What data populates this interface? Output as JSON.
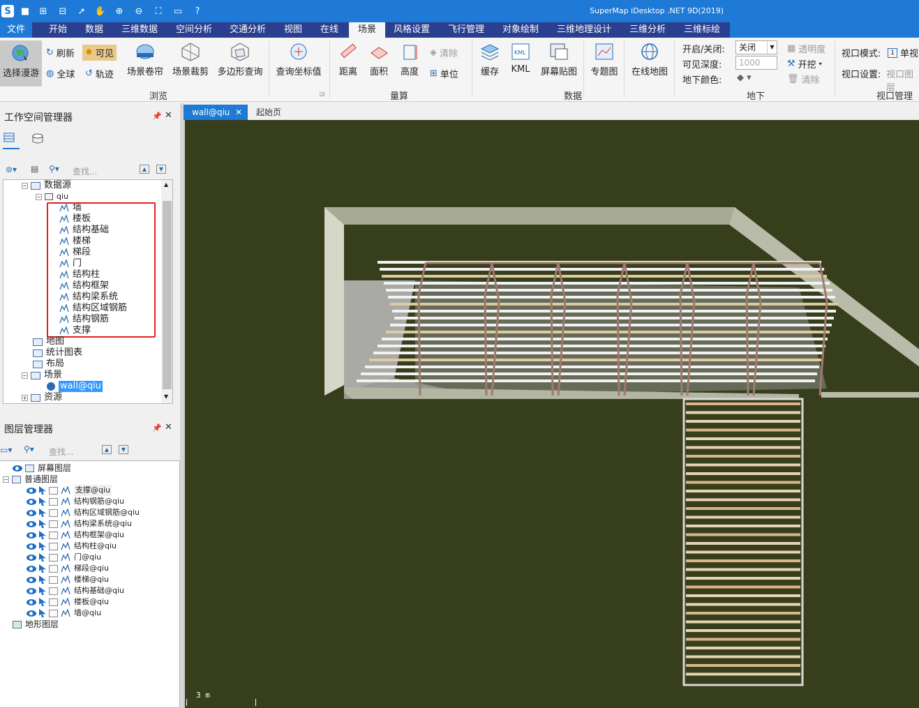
{
  "window": {
    "title": "SuperMap iDesktop .NET 9D(2019)"
  },
  "menu": [
    "文件",
    "开始",
    "数据",
    "三维数据",
    "空间分析",
    "交通分析",
    "视图",
    "在线",
    "场景",
    "风格设置",
    "飞行管理",
    "对象绘制",
    "三维地理设计",
    "三维分析",
    "三维标绘"
  ],
  "ribbon": {
    "browse": {
      "roam": "选择漫游",
      "refresh": "刷新",
      "visible": "可见",
      "full": "全球",
      "track": "轨迹",
      "scroll": "场景卷帘",
      "clip": "场景裁剪",
      "polyquery": "多边形查询",
      "coord": "查询坐标值",
      "label": "浏览"
    },
    "measure": {
      "distance": "距离",
      "area": "面积",
      "height": "高度",
      "clear": "清除",
      "unit": "单位",
      "label": "量算"
    },
    "data": {
      "cache": "缓存",
      "kml": "KML",
      "screenpaste": "屏幕贴图",
      "thematic": "专题图",
      "online": "在线地图",
      "label": "数据"
    },
    "underground": {
      "onoff_label": "开启/关闭:",
      "onoff_value": "关闭",
      "depth_label": "可见深度:",
      "depth_value": "1000",
      "color_label": "地下颜色:",
      "transparency": "透明度",
      "dig": "开挖",
      "clear": "清除",
      "label": "地下"
    },
    "viewport": {
      "mode_label": "视口模式:",
      "mode_value": "单视",
      "setting_label": "视口设置:",
      "setting_value": "视口图层",
      "label": "视口管理"
    }
  },
  "workspace": {
    "title": "工作空间管理器",
    "search_placeholder": "查找...",
    "tree": {
      "datasources": "数据源",
      "qiu": "qiu",
      "datasets": [
        "墙",
        "楼板",
        "结构基础",
        "楼梯",
        "梯段",
        "门",
        "结构柱",
        "结构框架",
        "结构梁系统",
        "结构区域钢筋",
        "结构钢筋",
        "支撑"
      ],
      "maps": "地图",
      "charts": "统计图表",
      "layouts": "布局",
      "scenes": "场景",
      "scene_item": "wall@qiu",
      "resources": "资源"
    }
  },
  "layers": {
    "title": "图层管理器",
    "search_placeholder": "查找...",
    "screen": "屏幕图层",
    "normal": "普通图层",
    "items": [
      "支撑@qiu",
      "结构钢筋@qiu",
      "结构区域钢筋@qiu",
      "结构梁系统@qiu",
      "结构框架@qiu",
      "结构柱@qiu",
      "门@qiu",
      "梯段@qiu",
      "楼梯@qiu",
      "结构基础@qiu",
      "楼板@qiu",
      "墙@qiu"
    ],
    "terrain": "地形图层"
  },
  "doc_tabs": [
    "wall@qiu",
    "起始页"
  ],
  "scene": {
    "scale": "3 m",
    "background": "#363e1c"
  }
}
